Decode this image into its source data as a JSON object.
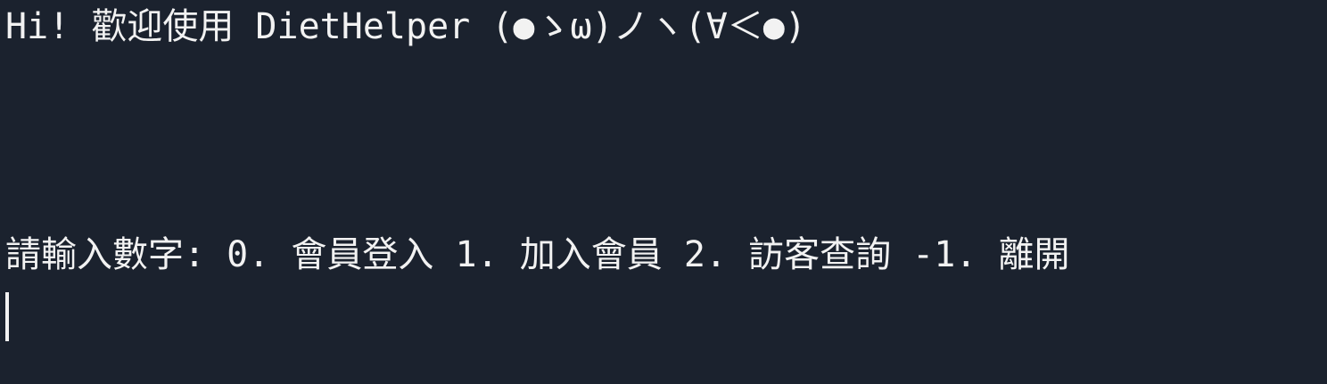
{
  "terminal": {
    "greeting": "Hi! 歡迎使用 DietHelper (●ゝω)ノヽ(∀＜●)",
    "prompt": "請輸入數字: 0. 會員登入 1. 加入會員 2. 訪客查詢 -1. 離開",
    "input_value": ""
  },
  "colors": {
    "background": "#1b222e",
    "foreground": "#f2f2f2"
  }
}
